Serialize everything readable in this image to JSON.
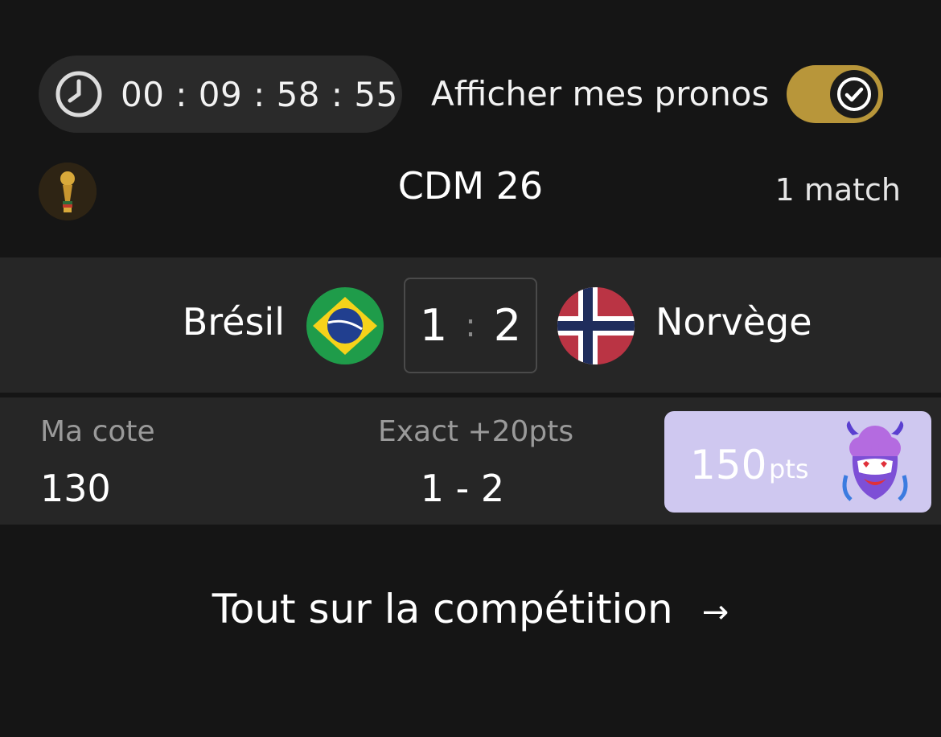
{
  "timer": {
    "value": "00 : 09 : 58 : 55"
  },
  "toggle": {
    "label": "Afficher mes pronos",
    "checked": true,
    "accent": "#b8963a"
  },
  "competition": {
    "title": "CDM 26",
    "match_count": "1 match",
    "logo": "world-cup-trophy-icon"
  },
  "match": {
    "home_team": "Brésil",
    "away_team": "Norvège",
    "home_score": "1",
    "away_score": "2",
    "separator": ":",
    "home_flag": "brazil-flag-icon",
    "away_flag": "norway-flag-icon"
  },
  "stats": {
    "cote_label": "Ma cote",
    "cote_value": "130",
    "exact_label": "Exact +20pts",
    "exact_value": "1 - 2"
  },
  "points": {
    "value": "150",
    "unit": "pts",
    "card_color": "#cfc8f0",
    "mascot": "mascot-icon"
  },
  "cta": {
    "label": "Tout sur la compétition",
    "arrow": "→"
  }
}
